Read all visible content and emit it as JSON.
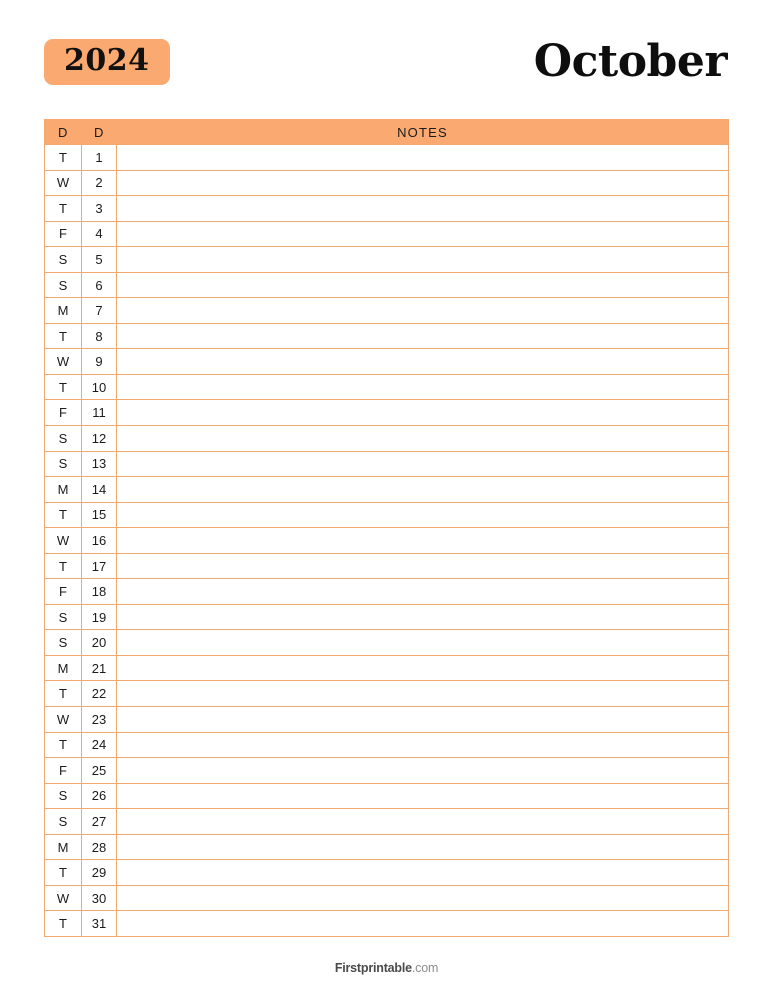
{
  "header": {
    "year": "2024",
    "month": "October"
  },
  "table": {
    "columns": [
      {
        "key": "dow",
        "label": "D"
      },
      {
        "key": "date",
        "label": "D"
      },
      {
        "key": "notes",
        "label": "NOTES"
      }
    ],
    "rows": [
      {
        "dow": "T",
        "date": "1",
        "notes": ""
      },
      {
        "dow": "W",
        "date": "2",
        "notes": ""
      },
      {
        "dow": "T",
        "date": "3",
        "notes": ""
      },
      {
        "dow": "F",
        "date": "4",
        "notes": ""
      },
      {
        "dow": "S",
        "date": "5",
        "notes": ""
      },
      {
        "dow": "S",
        "date": "6",
        "notes": ""
      },
      {
        "dow": "M",
        "date": "7",
        "notes": ""
      },
      {
        "dow": "T",
        "date": "8",
        "notes": ""
      },
      {
        "dow": "W",
        "date": "9",
        "notes": ""
      },
      {
        "dow": "T",
        "date": "10",
        "notes": ""
      },
      {
        "dow": "F",
        "date": "11",
        "notes": ""
      },
      {
        "dow": "S",
        "date": "12",
        "notes": ""
      },
      {
        "dow": "S",
        "date": "13",
        "notes": ""
      },
      {
        "dow": "M",
        "date": "14",
        "notes": ""
      },
      {
        "dow": "T",
        "date": "15",
        "notes": ""
      },
      {
        "dow": "W",
        "date": "16",
        "notes": ""
      },
      {
        "dow": "T",
        "date": "17",
        "notes": ""
      },
      {
        "dow": "F",
        "date": "18",
        "notes": ""
      },
      {
        "dow": "S",
        "date": "19",
        "notes": ""
      },
      {
        "dow": "S",
        "date": "20",
        "notes": ""
      },
      {
        "dow": "M",
        "date": "21",
        "notes": ""
      },
      {
        "dow": "T",
        "date": "22",
        "notes": ""
      },
      {
        "dow": "W",
        "date": "23",
        "notes": ""
      },
      {
        "dow": "T",
        "date": "24",
        "notes": ""
      },
      {
        "dow": "F",
        "date": "25",
        "notes": ""
      },
      {
        "dow": "S",
        "date": "26",
        "notes": ""
      },
      {
        "dow": "S",
        "date": "27",
        "notes": ""
      },
      {
        "dow": "M",
        "date": "28",
        "notes": ""
      },
      {
        "dow": "T",
        "date": "29",
        "notes": ""
      },
      {
        "dow": "W",
        "date": "30",
        "notes": ""
      },
      {
        "dow": "T",
        "date": "31",
        "notes": ""
      }
    ]
  },
  "footer": {
    "brand": "Firstprintable",
    "tld": ".com"
  },
  "colors": {
    "accent": "#faa971",
    "rule": "#f0a96f",
    "text": "#1b1b1b",
    "footer_brand": "#4a4a4a",
    "footer_tld": "#8c8c8c"
  }
}
